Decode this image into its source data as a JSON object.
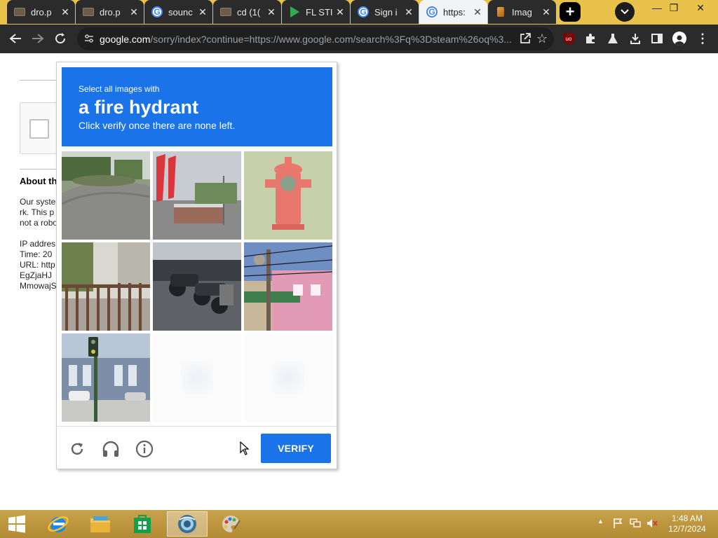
{
  "browser": {
    "tabs": [
      {
        "title": "dro.p",
        "favicon": "folder-icon",
        "active": false
      },
      {
        "title": "dro.p",
        "favicon": "folder-icon",
        "active": false
      },
      {
        "title": "sounc",
        "favicon": "google-icon",
        "active": false
      },
      {
        "title": "cd (1(",
        "favicon": "folder-icon",
        "active": false
      },
      {
        "title": "FL STI",
        "favicon": "play-store-icon",
        "active": false
      },
      {
        "title": "Sign i",
        "favicon": "google-icon",
        "active": false
      },
      {
        "title": "https:",
        "favicon": "google-icon",
        "active": true
      },
      {
        "title": "Imag",
        "favicon": "image-icon",
        "active": false
      }
    ],
    "new_tab_label": "+",
    "url_host": "google.com",
    "url_path": "/sorry/index?continue=https://www.google.com/search%3Fq%3Dsteam%26oq%3..."
  },
  "page": {
    "about_title": "About th",
    "lines": [
      "Our syste",
      "rk. This p",
      "not a robo",
      "IP addres",
      "Time: 20",
      "URL: http",
      "EgZjaHJ",
      "MmowajS"
    ]
  },
  "challenge": {
    "instruction_small": "Select all images with",
    "instruction_big": "a fire hydrant",
    "instruction_sub": "Click verify once there are none left.",
    "verify_label": "VERIFY",
    "tiles": [
      "roundabout-road",
      "storefront-flags",
      "fire-hydrant",
      "fence-stairs",
      "parked-motorcycles",
      "pink-building-wires",
      "traffic-light-building",
      "empty",
      "empty"
    ]
  },
  "taskbar": {
    "time": "1:48 AM",
    "date": "12/7/2024"
  },
  "colors": {
    "accent": "#1a73e8",
    "taskbar": "#c9a24c",
    "browser_dark": "#2b2b2b"
  }
}
